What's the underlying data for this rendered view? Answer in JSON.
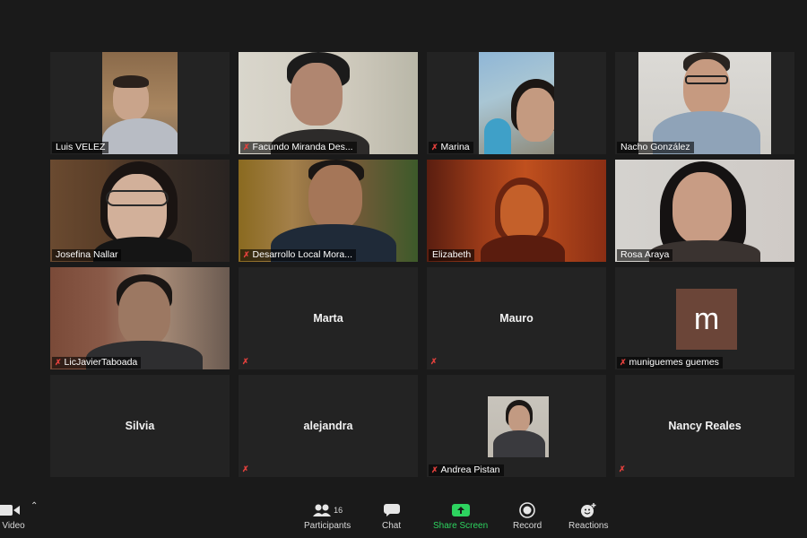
{
  "meeting": {
    "participant_count": "16",
    "active_speaker_color": "#b9e34c",
    "muted_icon_color": "#e0403c"
  },
  "tiles": [
    {
      "name": "Luis VELEZ",
      "muted": false
    },
    {
      "name": "Facundo Miranda Des...",
      "muted": true
    },
    {
      "name": "Marina",
      "muted": true
    },
    {
      "name": "Nacho González",
      "muted": false
    },
    {
      "name": "Josefina Nallar",
      "muted": false,
      "active": true
    },
    {
      "name": "Desarrollo Local Mora...",
      "muted": true
    },
    {
      "name": "Elizabeth",
      "muted": false
    },
    {
      "name": "Rosa Araya",
      "muted": false
    },
    {
      "name": "LicJavierTaboada",
      "muted": true
    },
    {
      "name": "Marta",
      "muted": true,
      "video": false
    },
    {
      "name": "Mauro",
      "muted": true,
      "video": false
    },
    {
      "name": "muniguemes guemes",
      "muted": true,
      "video": false,
      "avatar_letter": "m",
      "avatar_color": "#6b4538"
    },
    {
      "name": "Silvia",
      "muted": false,
      "video": false
    },
    {
      "name": "alejandra",
      "muted": true,
      "video": false
    },
    {
      "name": "Andrea Pistan",
      "muted": true,
      "video": false,
      "has_photo": true
    },
    {
      "name": "Nancy Reales",
      "muted": true,
      "video": false
    }
  ],
  "toolbar": {
    "stop_video_label": "p Video",
    "participants_label": "Participants",
    "chat_label": "Chat",
    "share_screen_label": "Share Screen",
    "share_screen_color": "#2dd35f",
    "record_label": "Record",
    "reactions_label": "Reactions"
  }
}
